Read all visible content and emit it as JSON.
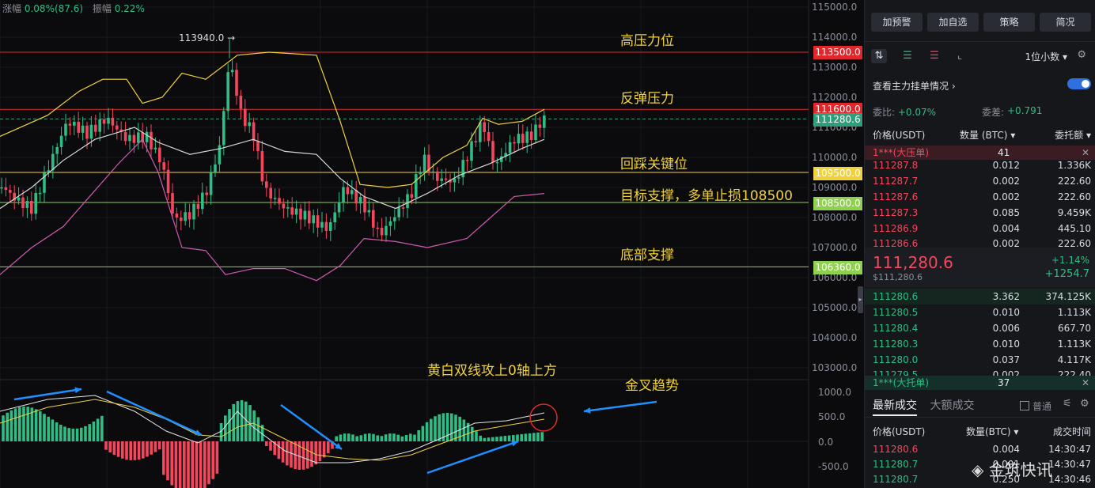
{
  "stats": {
    "change_label": "涨幅",
    "change_value": "0.08%(87.6)",
    "amplitude_label": "振幅",
    "amplitude_value": "0.22%"
  },
  "peak_label": "113940.0 →",
  "annotations": [
    {
      "id": "resist-high",
      "text": "高压力位"
    },
    {
      "id": "rebound",
      "text": "反弹压力"
    },
    {
      "id": "key",
      "text": "回踩关键位"
    },
    {
      "id": "target",
      "text": "目标支撑，多单止损108500"
    },
    {
      "id": "bottom",
      "text": "底部支撑"
    },
    {
      "id": "macd-cross",
      "text": "黄白双线攻上0轴上方"
    },
    {
      "id": "golden",
      "text": "金叉趋势"
    }
  ],
  "price_levels": [
    {
      "value": "113500.0",
      "color": "#e0272c"
    },
    {
      "value": "111600.0",
      "color": "#e0272c"
    },
    {
      "value": "111280.6",
      "color": "#2f9e7a"
    },
    {
      "value": "109500.0",
      "color": "#f0d23c"
    },
    {
      "value": "108500.0",
      "color": "#8fd14f"
    },
    {
      "value": "106360.0",
      "color": "#8fd14f"
    }
  ],
  "y_axis": [
    "115000.0",
    "114000.0",
    "113000.0",
    "112000.0",
    "111000.0",
    "110000.0",
    "109000.0",
    "108000.0",
    "107000.0",
    "106000.0",
    "105000.0",
    "104000.0",
    "103000.0"
  ],
  "macd_axis": [
    "1000.0",
    "500.0",
    "0.0",
    "-500.0"
  ],
  "toolbar": {
    "buttons": [
      "加预警",
      "加自选",
      "策略",
      "简况"
    ]
  },
  "view": {
    "decimal": "1位小数 ▾"
  },
  "orderbook": {
    "title": "查看主力挂单情况 ›",
    "ratio_label": "委比:",
    "ratio_value": "+0.07%",
    "diff_label": "委差:",
    "diff_value": "+0.791",
    "col_price": "价格(USDT)",
    "col_qty": "数量 (BTC) ▾",
    "col_total": "委托额 ▾",
    "sell_band": {
      "label": "1***(大压单)",
      "count": "41"
    },
    "asks": [
      {
        "price": "111287.8",
        "qty": "0.012",
        "total": "1.336K"
      },
      {
        "price": "111287.7",
        "qty": "0.002",
        "total": "222.60"
      },
      {
        "price": "111287.6",
        "qty": "0.002",
        "total": "222.60"
      },
      {
        "price": "111287.3",
        "qty": "0.085",
        "total": "9.459K"
      },
      {
        "price": "111286.9",
        "qty": "0.004",
        "total": "445.10"
      },
      {
        "price": "111286.6",
        "qty": "0.002",
        "total": "222.60"
      }
    ],
    "last": {
      "price": "111,280.6",
      "usd": "$111,280.6",
      "pct": "+1.14%",
      "chg": "+1254.7"
    },
    "bids": [
      {
        "price": "111280.6",
        "qty": "3.362",
        "total": "374.125K"
      },
      {
        "price": "111280.5",
        "qty": "0.010",
        "total": "1.113K"
      },
      {
        "price": "111280.4",
        "qty": "0.006",
        "total": "667.70"
      },
      {
        "price": "111280.3",
        "qty": "0.010",
        "total": "1.113K"
      },
      {
        "price": "111280.0",
        "qty": "0.037",
        "total": "4.117K"
      },
      {
        "price": "111279.5",
        "qty": "0.002",
        "total": "222.40"
      }
    ],
    "buy_band": {
      "label": "1***(大托单)",
      "count": "37"
    }
  },
  "trades": {
    "tab_latest": "最新成交",
    "tab_large": "大额成交",
    "normal_label": "普通",
    "col_price": "价格(USDT)",
    "col_qty": "数量(BTC) ▾",
    "col_time": "成交时间",
    "rows": [
      {
        "price": "111280.6",
        "qty": "0.004",
        "time": "14:30:47"
      },
      {
        "price": "111280.7",
        "qty": "0.001",
        "time": "14:30:47"
      },
      {
        "price": "111280.7",
        "qty": "0.250",
        "time": "14:30:46"
      }
    ]
  },
  "watermark": "◈ 金筑快讯",
  "colors": {
    "up": "#2ebd85",
    "down": "#f6465d",
    "ma_yellow": "#f0d23c",
    "ma_white": "#d8d8d8",
    "ma_pink": "#d05ab0",
    "arrow_blue": "#1e90ff"
  }
}
